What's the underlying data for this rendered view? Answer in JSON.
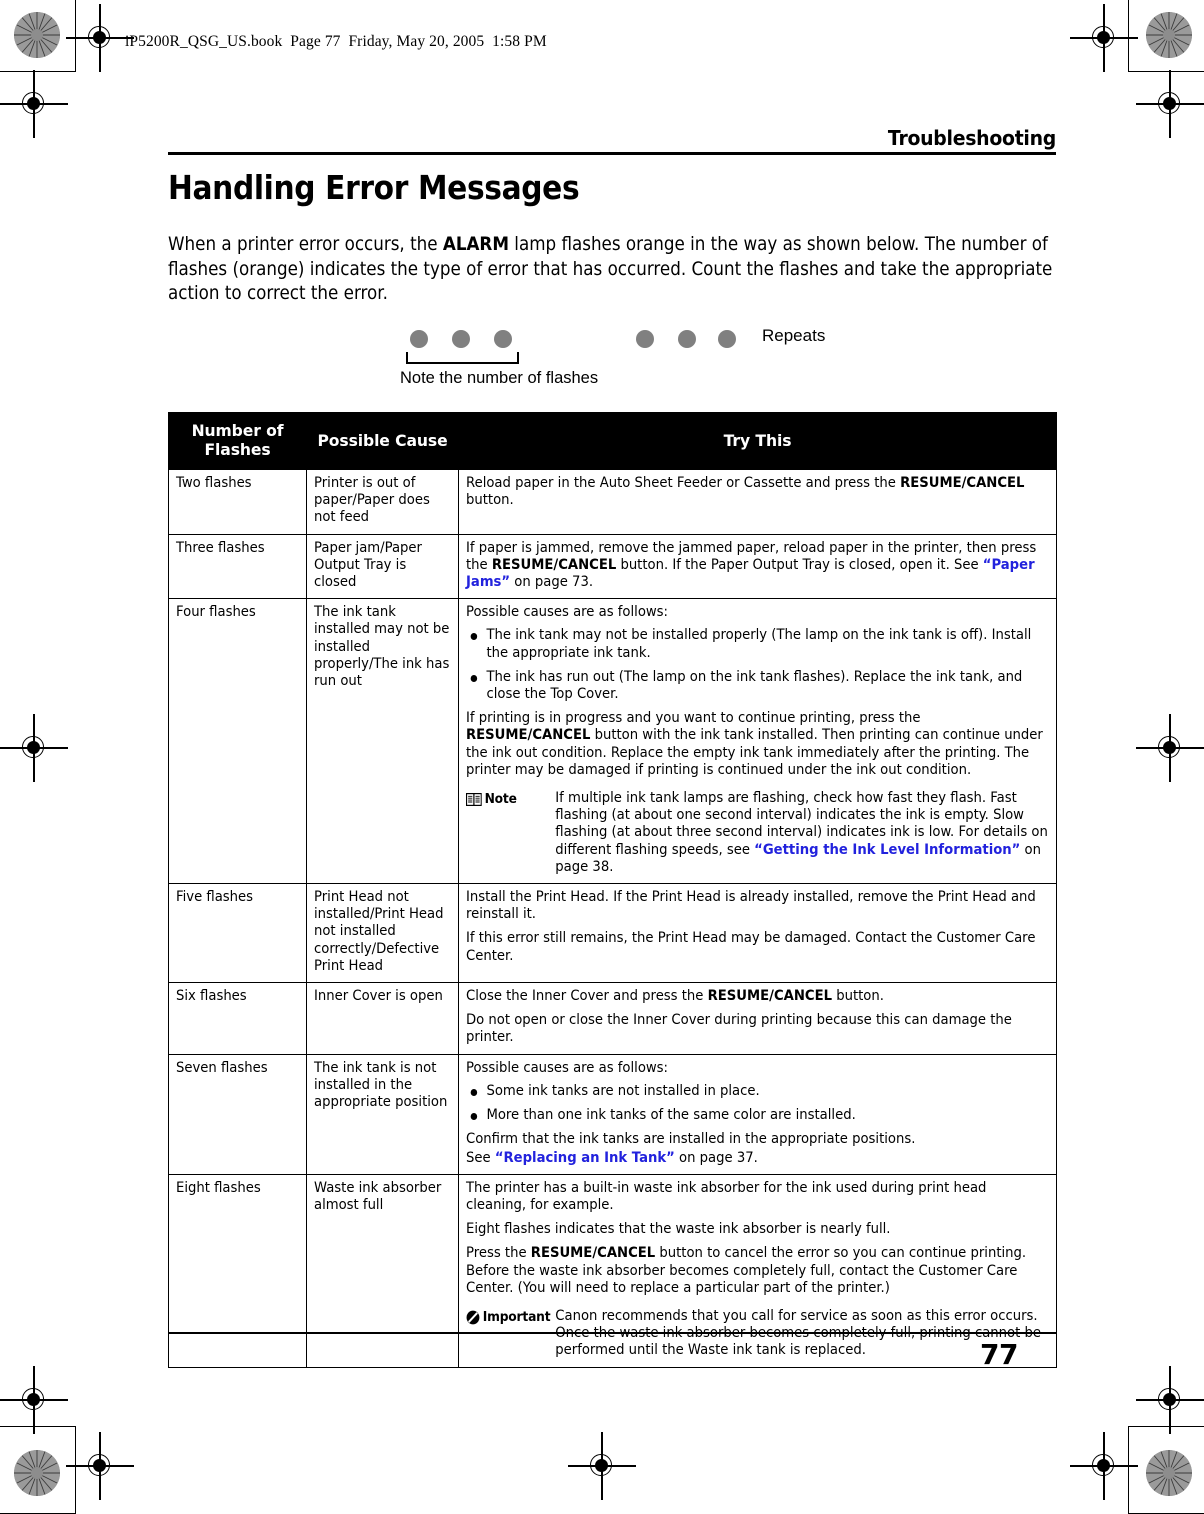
{
  "print_marks": {
    "file_stamp": "iP5200R_QSG_US.book  Page 77  Friday, May 20, 2005  1:58 PM"
  },
  "header": {
    "running_head": "Troubleshooting",
    "title": "Handling Error Messages"
  },
  "intro": {
    "text_before_bold": "When a printer error occurs, the ",
    "bold_term": "ALARM",
    "text_after_bold": " lamp flashes orange in the way as shown below. The number of flashes (orange) indicates the type of error that has occurred. Count the flashes and take the appropriate action to correct the error."
  },
  "flash_diagram": {
    "group1_dots": 3,
    "group2_dots": 3,
    "caption": "Note the number of flashes",
    "repeats_label": "Repeats",
    "dot_color": "#808080"
  },
  "table": {
    "headers": {
      "col1": "Number of\nFlashes",
      "col1_line1": "Number of",
      "col1_line2": "Flashes",
      "col2": "Possible Cause",
      "col3": "Try This"
    },
    "rows": [
      {
        "flashes": "Two flashes",
        "cause": "Printer is out of paper/Paper does not feed",
        "try_p1_a": "Reload paper in the Auto Sheet Feeder or Cassette and press the ",
        "try_p1_b": "RESUME/CANCEL",
        "try_p1_c": " button."
      },
      {
        "flashes": "Three flashes",
        "cause": "Paper jam/Paper Output Tray is closed",
        "try_p1_a": "If paper is jammed, remove the jammed paper, reload paper in the printer, then press the ",
        "try_p1_b": "RESUME/CANCEL",
        "try_p1_c": " button. If the Paper Output Tray is closed, open it. See ",
        "try_link": "“Paper Jams”",
        "try_p1_d": " on page 73."
      },
      {
        "flashes": "Four flashes",
        "cause": "The ink tank installed may not be installed properly/The ink has run out",
        "intro_line": "Possible causes are as follows:",
        "bullets": [
          "The ink tank may not be installed properly (The lamp on the ink tank is off). Install the appropriate ink tank.",
          "The ink has run out (The lamp on the ink tank flashes). Replace the ink tank, and close the Top Cover."
        ],
        "para_a": "If printing is in progress and you want to continue printing, press the ",
        "para_b": "RESUME/CANCEL",
        "para_c": " button with the ink tank installed. Then printing can continue under the ink out condition. Replace the empty ink tank immediately after the printing. The printer may be damaged if printing is continued under the ink out condition.",
        "note": {
          "label": "Note",
          "icon": "book-icon",
          "text_a": "If multiple ink tank lamps are flashing, check how fast they flash. Fast flashing (at about one second interval) indicates the ink is empty. Slow flashing (at about three second interval) indicates ink is low. For details on different flashing speeds, see ",
          "link": "“Getting the Ink Level Information”",
          "text_b": " on page 38."
        }
      },
      {
        "flashes": "Five flashes",
        "cause": "Print Head not installed/Print Head not installed correctly/Defective Print Head",
        "para1": "Install the Print Head. If the Print Head is already installed, remove the Print Head and reinstall it.",
        "para2": "If this error still remains, the Print Head may be damaged. Contact the Customer Care Center."
      },
      {
        "flashes": "Six flashes",
        "cause": "Inner Cover is open",
        "para1_a": "Close the Inner Cover and press the ",
        "para1_b": "RESUME/CANCEL",
        "para1_c": " button.",
        "para2": "Do not open or close the Inner Cover during printing because this can damage the printer."
      },
      {
        "flashes": "Seven flashes",
        "cause": "The ink tank is not installed in the appropriate position",
        "intro_line": "Possible causes are as follows:",
        "bullets": [
          "Some ink tanks are not installed in place.",
          "More than one ink tanks of the same color are installed."
        ],
        "para1": "Confirm that the ink tanks are installed in the appropriate positions.",
        "para2_a": "See ",
        "para2_link": "“Replacing an Ink Tank”",
        "para2_b": " on page 37."
      },
      {
        "flashes": "Eight flashes",
        "cause": "Waste ink absorber almost full",
        "para1": "The printer has a built-in waste ink absorber for the ink used during print head cleaning, for example.",
        "para2": "Eight flashes indicates that the waste ink absorber is nearly full.",
        "para3_a": "Press the ",
        "para3_b": "RESUME/CANCEL",
        "para3_c": " button to cancel the error so you can continue printing. Before the waste ink absorber becomes completely full, contact the Customer Care Center. (You will need to replace a particular part of the printer.)",
        "important": {
          "label": "Important",
          "icon": "important-icon",
          "text": "Canon recommends that you call for service as soon as this error occurs. Once the waste ink absorber becomes completely full, printing cannot be performed until the Waste ink tank is replaced."
        }
      }
    ]
  },
  "footer": {
    "page_number": "77"
  },
  "colors": {
    "link": "#2222dd",
    "header_bg": "#000000",
    "header_fg": "#ffffff",
    "flash_dot": "#808080"
  }
}
